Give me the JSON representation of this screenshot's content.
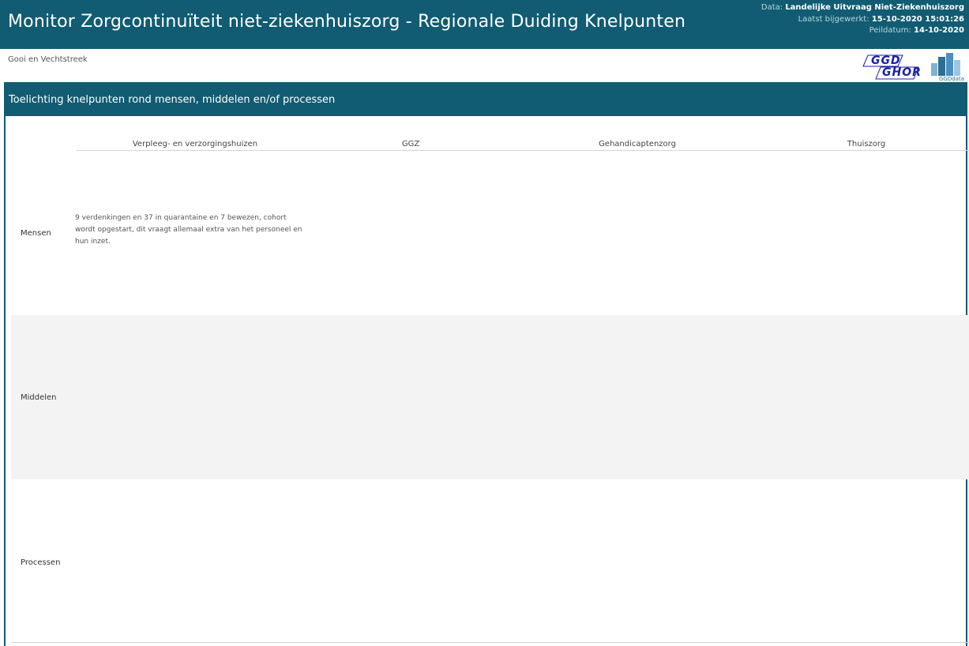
{
  "header": {
    "title": "Monitor Zorgcontinuïteit niet-ziekenhuiszorg - Regionale Duiding Knelpunten",
    "data_label": "Data:",
    "data_value": "Landelijke Uitvraag Niet-Ziekenhuiszorg",
    "updated_label": "Laatst bijgewerkt:",
    "updated_value": "15-10-2020 15:01:26",
    "peildatum_label": "Peildatum:",
    "peildatum_value": "14-10-2020"
  },
  "region": "Gooi en Vechtstreek",
  "logos": {
    "ggd_line1": "GGD",
    "ggd_line2": "GHOR",
    "ggddata": "GGDdata"
  },
  "panel": {
    "title": "Toelichting knelpunten rond mensen, middelen en/of processen"
  },
  "table": {
    "columns": [
      "Verpleeg- en verzorgingshuizen",
      "GGZ",
      "Gehandicaptenzorg",
      "Thuiszorg"
    ],
    "rows": [
      {
        "label": "Mensen",
        "cells": [
          "9 verdenkingen en 37 in quarantaine en 7 bewezen, cohort wordt opgestart, dit vraagt allemaal extra van het personeel en hun inzet.",
          "",
          "",
          ""
        ]
      },
      {
        "label": "Middelen",
        "cells": [
          "",
          "",
          "",
          ""
        ]
      },
      {
        "label": "Processen",
        "cells": [
          "",
          "",
          "",
          ""
        ]
      }
    ]
  },
  "colors": {
    "brand": "#115c72",
    "row_alt": "#f3f3f3",
    "ggd_blue": "#1a1fa8"
  }
}
